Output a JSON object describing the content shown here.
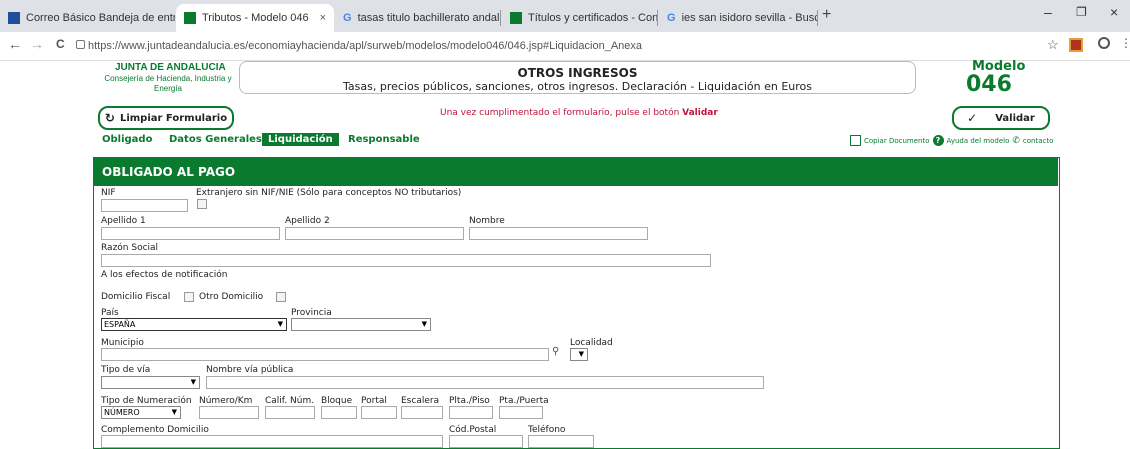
{
  "browser": {
    "tabs": [
      {
        "label": "Correo Básico Bandeja de entrad",
        "close": "×"
      },
      {
        "label": "Tributos - Modelo 046",
        "close": "×"
      },
      {
        "label": "tasas titulo bachillerato andaluc",
        "close": "×"
      },
      {
        "label": "Títulos y certificados - Consejeri",
        "close": "×"
      },
      {
        "label": "ies san isidoro sevilla - Buscar co",
        "close": "×"
      }
    ],
    "new_tab": "+",
    "url": "https://www.juntadeandalucia.es/economiayhacienda/apl/surweb/modelos/modelo046/046.jsp#Liquidacion_Anexa",
    "nav": {
      "back": "←",
      "forward": "→",
      "reload": "C"
    }
  },
  "header": {
    "org_name": "JUNTA DE ANDALUCIA",
    "org_dept": "Consejería de Hacienda, Industria y Energía",
    "title": "OTROS INGRESOS",
    "subtitle": "Tasas, precios públicos, sanciones, otros ingresos. Declaración - Liquidación en Euros",
    "modelo_label": "Modelo",
    "modelo_number": "046"
  },
  "actions": {
    "clear": "Limpiar Formulario",
    "notice_prefix": "Una vez cumplimentado el formulario, pulse el botón ",
    "notice_strong": "Validar",
    "validate": "Validar"
  },
  "tabs": [
    "Obligado",
    "Datos Generales",
    "Liquidación",
    "Responsable"
  ],
  "links": {
    "copy": "Copiar Documento",
    "help": "Ayuda del modelo",
    "contact": "contacto"
  },
  "form": {
    "section_title": "OBLIGADO AL PAGO",
    "nif": "NIF",
    "extranjero": "Extranjero sin NIF/NIE (Sólo para conceptos NO tributarios)",
    "apellido1": "Apellido 1",
    "apellido2": "Apellido 2",
    "nombre": "Nombre",
    "razon_social": "Razón Social",
    "notificacion": "A los efectos de notificación",
    "domicilio_fiscal": "Domicilio Fiscal",
    "otro_domicilio": "Otro Domicilio",
    "pais": "País",
    "pais_value": "ESPAÑA",
    "provincia": "Provincia",
    "municipio": "Municipio",
    "localidad": "Localidad",
    "tipo_via": "Tipo de vía",
    "nombre_via": "Nombre vía pública",
    "tipo_numeracion": "Tipo de Numeración",
    "tipo_numeracion_value": "NÚMERO",
    "numero_km": "Número/Km",
    "calif_num": "Calif. Núm.",
    "bloque": "Bloque",
    "portal": "Portal",
    "escalera": "Escalera",
    "plta_piso": "Plta./Piso",
    "pta_puerta": "Pta./Puerta",
    "complemento": "Complemento Domicilio",
    "cod_postal": "Cód.Postal",
    "telefono": "Teléfono"
  },
  "colors": {
    "brand_green": "#0a7a2f",
    "notice_red": "#c0143c"
  }
}
